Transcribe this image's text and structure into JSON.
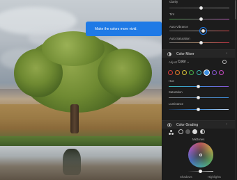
{
  "tooltip": {
    "text": "Make the colors more vivid."
  },
  "panel": {
    "top_sliders": [
      {
        "label": "Clarity",
        "value": "0",
        "position": 0.5,
        "track": "gray"
      },
      {
        "label": "Tint",
        "value": "0",
        "position": 0.5,
        "track": "tint"
      },
      {
        "label": "Auto Vibrance",
        "value": "",
        "position": 0.55,
        "track": "vibrance",
        "active": true
      },
      {
        "label": "Auto Saturation",
        "value": "",
        "position": 0.55,
        "track": "saturation"
      }
    ],
    "color_mixer": {
      "title": "Color Mixer",
      "adjust_label": "Adjust",
      "adjust_value": "Color",
      "swatches": [
        {
          "name": "red",
          "color": "#d83b3b"
        },
        {
          "name": "orange",
          "color": "#e07a2a"
        },
        {
          "name": "yellow",
          "color": "#d8c238"
        },
        {
          "name": "green",
          "color": "#48b24a"
        },
        {
          "name": "aqua",
          "color": "#3bb5b0"
        },
        {
          "name": "blue",
          "color": "#3c8fe0",
          "selected": true
        },
        {
          "name": "purple",
          "color": "#8a55d6"
        },
        {
          "name": "magenta",
          "color": "#c84bc2"
        }
      ],
      "sliders": [
        {
          "label": "Hue",
          "position": 0.58
        },
        {
          "label": "Saturation",
          "position": 0.58
        },
        {
          "label": "Luminance",
          "position": 0.58
        }
      ]
    },
    "color_grading": {
      "title": "Color Grading",
      "wheel_label": "Midtones",
      "bottom_left": "Shadows",
      "bottom_right": "Highlights"
    }
  },
  "colors": {
    "accent": "#1f7ae6",
    "panel_bg": "#1c1c1c"
  }
}
